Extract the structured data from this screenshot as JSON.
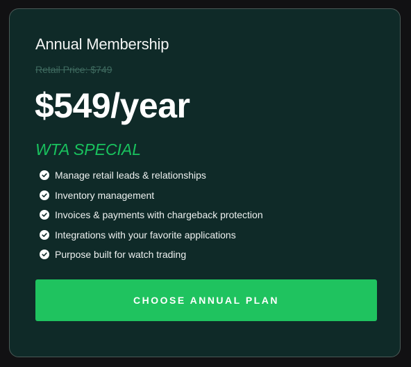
{
  "plan": {
    "name": "Annual Membership",
    "retail_price": "Retail Price: $749",
    "price": "$549/year",
    "special_label": "WTA SPECIAL",
    "features": [
      {
        "label": "Manage retail leads & relationships",
        "icon": "check-circle-icon"
      },
      {
        "label": "Inventory management",
        "icon": "check-circle-icon"
      },
      {
        "label": "Invoices & payments with chargeback protection",
        "icon": "check-circle-icon"
      },
      {
        "label": "Integrations with your favorite applications",
        "icon": "check-circle-icon"
      },
      {
        "label": "Purpose built for watch trading",
        "icon": "check-circle-icon"
      }
    ],
    "cta_label": "CHOOSE ANNUAL PLAN"
  },
  "colors": {
    "page_background": "#111113",
    "card_background": "#0f2a28",
    "card_border": "#4a5a57",
    "accent_green": "#1fc35f",
    "special_text": "#19c25e",
    "strikethrough_text": "#3f6b60"
  }
}
